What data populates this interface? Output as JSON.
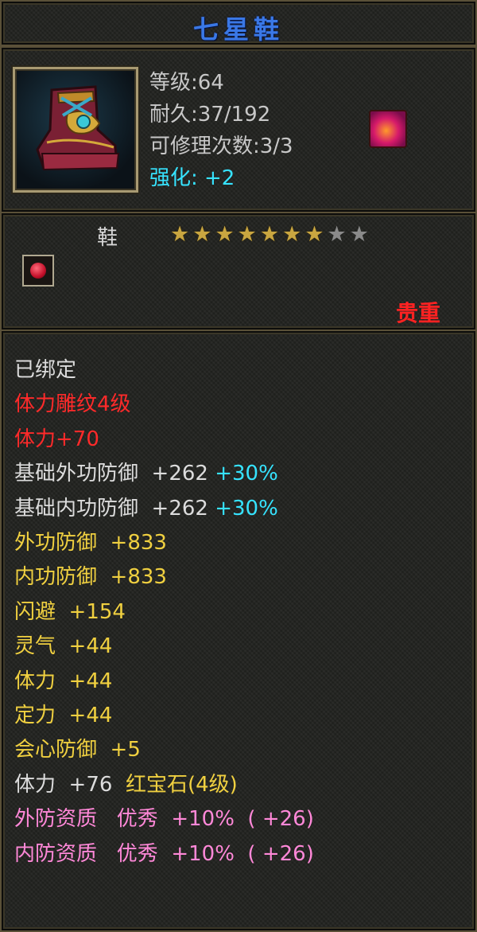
{
  "item": {
    "name": "七星鞋",
    "level": "等级:64",
    "durability": "耐久:37/192",
    "repair": "可修理次数:3/3",
    "enhance": "强化: +2",
    "type": "鞋",
    "stars_filled": 7,
    "stars_total": 9,
    "rarity": "贵重",
    "icon": "boot-icon",
    "badge_icon": "fire-element-icon",
    "gem_slot_icon": "red-gem-icon"
  },
  "attributes": [
    {
      "text": "已绑定",
      "color": "white"
    },
    {
      "text": "体力雕纹4级",
      "color": "red"
    },
    {
      "text": "体力+70",
      "color": "red"
    },
    {
      "text": "基础外功防御  +262 ",
      "color": "white",
      "extra": "+30%",
      "extra_color": "cyan"
    },
    {
      "text": "基础内功防御  +262 ",
      "color": "white",
      "extra": "+30%",
      "extra_color": "cyan"
    },
    {
      "text": "外功防御  +833",
      "color": "yellow"
    },
    {
      "text": "内功防御  +833",
      "color": "yellow"
    },
    {
      "text": "闪避  +154",
      "color": "yellow"
    },
    {
      "text": "灵气  +44",
      "color": "yellow"
    },
    {
      "text": "体力  +44",
      "color": "yellow"
    },
    {
      "text": "定力  +44",
      "color": "yellow"
    },
    {
      "text": "会心防御  +5",
      "color": "yellow"
    },
    {
      "text": "体力  +76  ",
      "color": "white",
      "extra": "红宝石(4级)",
      "extra_color": "yellow"
    },
    {
      "text": "外防资质   优秀  +10%  ( +26)",
      "color": "pink"
    },
    {
      "text": "内防资质   优秀  +10%  ( +26)",
      "color": "pink"
    }
  ],
  "colors": {
    "title": "#3a78e6",
    "cyan": "#36e3ff",
    "red": "#ff2a2a",
    "yellow": "#f0d040",
    "pink": "#ff88d8",
    "white": "#dcdcdc"
  }
}
